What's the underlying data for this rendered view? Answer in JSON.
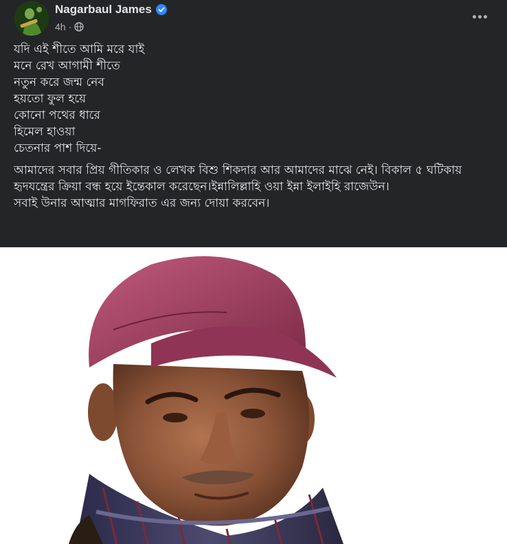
{
  "post": {
    "author": "Nagarbaul James",
    "time": "4h",
    "separator": "·",
    "poem": [
      "যদি এই শীতে আমি মরে যাই",
      "মনে রেখ আগামী শীতে",
      "নতুন করে জন্ম নেব",
      "হয়তো ফুল হয়ে",
      "কোনো পথের ধারে",
      "হিমেল হাওয়া",
      "চেতনার পাশ দিয়ে-"
    ],
    "paragraph_1": "আমাদের সবার প্রিয় গীতিকার ও লেখক বিশু শিকদার আর আমাদের মাঝে নেই। বিকাল ৫ ঘটিকায় হৃদযন্ত্রের ক্রিয়া বন্ধ হয়ে ইন্তেকাল করেছেন।ইন্নালিল্লাহি ওয়া ইন্না ইলাইহি রাজেউন।",
    "paragraph_2": "সবাই উনার আত্মার মাগফিরাত এর জন্য দোয়া করবেন।"
  },
  "icons": {
    "verified": "verified-badge-icon",
    "audience": "globe-icon",
    "more": "more-options-icon"
  },
  "colors": {
    "background": "#242526",
    "primary_text": "#e4e6eb",
    "secondary_text": "#b0b3b8",
    "verified_blue": "#2d88ff",
    "photo_background": "#ffffff"
  }
}
